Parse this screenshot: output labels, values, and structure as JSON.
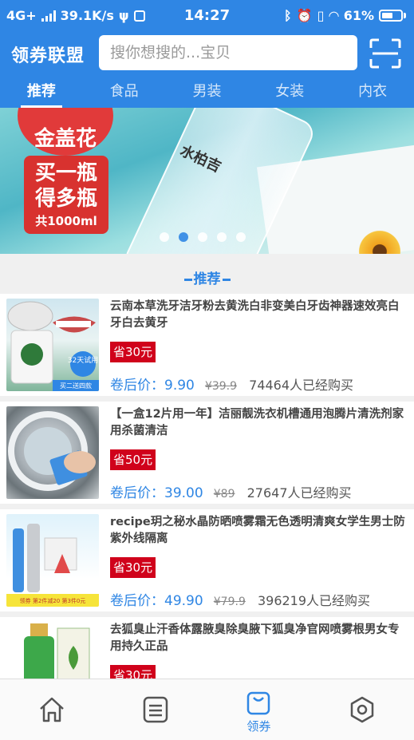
{
  "status_bar": {
    "network": "4G+",
    "speed": "39.1K/s",
    "time": "14:27",
    "battery": "61%",
    "battery_level": 0.61
  },
  "header": {
    "app_title": "领券联盟",
    "search_placeholder": "搜你想搜的...宝贝"
  },
  "tabs": [
    {
      "label": "推荐",
      "active": true
    },
    {
      "label": "食品",
      "active": false
    },
    {
      "label": "男装",
      "active": false
    },
    {
      "label": "女装",
      "active": false
    },
    {
      "label": "内衣",
      "active": false
    }
  ],
  "banner": {
    "offer_line1": "买一瓶",
    "offer_line2": "得多瓶",
    "offer_volume": "共1000ml",
    "top_text": "金盖花",
    "bottle_text": "水柏吉",
    "active_dot": 1,
    "dot_count": 5
  },
  "section_title": "推荐",
  "products": [
    {
      "name": "云南本草洗牙洁牙粉去黄洗白非变美白牙齿神器速效亮白牙白去黄牙",
      "coupon": "省30元",
      "price_label": "卷后价：",
      "price": "9.90",
      "original_price": "¥39.9",
      "sold": "74464人已经购买",
      "thumb_badge": "32天试用",
      "thumb_caption": "买二送四款"
    },
    {
      "name": "【一盒12片用一年】洁丽靓洗衣机槽通用泡腾片清洗剂家用杀菌清洁",
      "coupon": "省50元",
      "price_label": "卷后价：",
      "price": "39.00",
      "original_price": "¥89",
      "sold": "27647人已经购买"
    },
    {
      "name": "recipe玥之秘水晶防晒喷雾霜无色透明清爽女学生男士防紫外线隔离",
      "coupon": "省30元",
      "price_label": "卷后价：",
      "price": "49.90",
      "original_price": "¥79.9",
      "sold": "396219人已经购买",
      "thumb_caption": "领券 第2件减20 第3件0元"
    },
    {
      "name": "去狐臭止汗香体露腋臭除臭腋下狐臭净官网喷雾根男女专用持久正品",
      "coupon": "省30元"
    }
  ],
  "bottom_nav": [
    {
      "icon": "home-icon",
      "label": "",
      "active": false
    },
    {
      "icon": "list-icon",
      "label": "",
      "active": false
    },
    {
      "icon": "bag-icon",
      "label": "领券",
      "active": true
    },
    {
      "icon": "settings-hex-icon",
      "label": "",
      "active": false
    }
  ],
  "colors": {
    "primary": "#2f86e4",
    "coupon_red": "#d0021b"
  }
}
